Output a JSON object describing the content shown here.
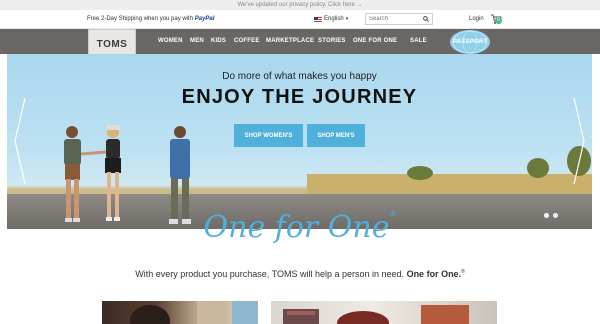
{
  "policy_bar": {
    "text": "We've updated our privacy policy. Click here →"
  },
  "topbar": {
    "shipping_text": "Free 2-Day Shipping when you pay with",
    "shipping_brand": "PayPal",
    "language": "English",
    "search_placeholder": "Search",
    "login": "Login",
    "cart_count": "0"
  },
  "nav": {
    "logo": "TOMS",
    "items": [
      "WOMEN",
      "MEN",
      "KIDS",
      "COFFEE",
      "MARKETPLACE",
      "STORIES",
      "ONE FOR ONE",
      "SALE"
    ],
    "passport_badge": "PASSPORT"
  },
  "hero": {
    "subtitle": "Do more of what makes you happy",
    "title": "ENJOY THE JOURNEY",
    "button_women": "SHOP WOMEN'S",
    "button_men": "SHOP MEN'S",
    "active_slide": 1,
    "slide_count": 2
  },
  "one_for_one": {
    "script": "One for One",
    "reg": "®",
    "tagline_prefix": "With every product you purchase, TOMS will help a person in need.",
    "tagline_bold": "One for One.",
    "tagline_reg": "®"
  },
  "colors": {
    "accent": "#4fb0dc",
    "nav_bg": "#6a6663",
    "cart_badge": "#4fb88b"
  }
}
